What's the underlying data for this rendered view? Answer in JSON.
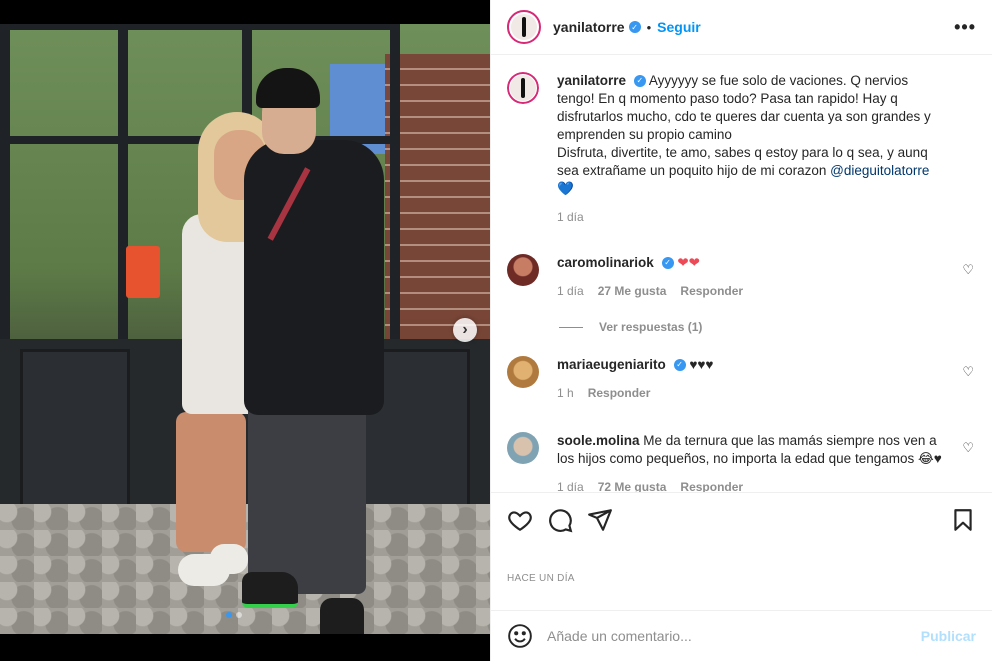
{
  "post": {
    "username": "yanilatorre",
    "follow_label": "Seguir",
    "dot": "•",
    "more_label": "•••"
  },
  "caption": {
    "username": "yanilatorre",
    "text": "Ayyyyyy se fue solo de vaciones. Q nervios tengo! En q momento paso todo? Pasa tan rapido! Hay q disfrutarlos mucho, cdo te queres dar cuenta ya son grandes y emprenden su propio camino",
    "text2": "Disfruta, divertite, te amo, sabes q estoy para lo q sea, y aunq sea extrañame un poquito hijo de mi corazon ",
    "mention": "@dieguitolatorre",
    "heart": "💙",
    "time": "1 día"
  },
  "comments": [
    {
      "username": "caromolinariok",
      "text": "❤❤",
      "time": "1 día",
      "likes": "27 Me gusta",
      "reply": "Responder",
      "view_replies": "Ver respuestas (1)"
    },
    {
      "username": "mariaeugeniarito",
      "text": "♥♥♥",
      "time": "1 h",
      "reply": "Responder"
    },
    {
      "username": "soole.molina",
      "text": "Me da ternura que las mamás siempre nos ven a los hijos como pequeños, no importa la edad que tengamos ",
      "emoji": "😂♥",
      "time": "1 día",
      "likes": "72 Me gusta",
      "reply": "Responder"
    }
  ],
  "footer": {
    "time_ago": "HACE UN DÍA",
    "comment_placeholder": "Añade un comentario...",
    "publish_label": "Publicar"
  },
  "icons": {
    "like": "heart-icon",
    "comment": "comment-icon",
    "share": "send-icon",
    "save": "bookmark-icon",
    "emoji": "emoji-icon",
    "next": "chevron-right-icon"
  },
  "colors": {
    "accent": "#0095f6",
    "verified": "#3897f0",
    "muted": "#8e8e8e",
    "publish_disabled": "#b2dffc"
  }
}
